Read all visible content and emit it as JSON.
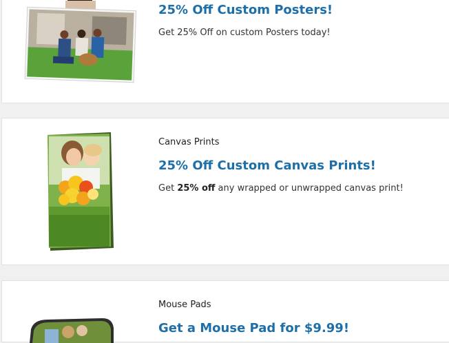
{
  "offers": [
    {
      "title": "25% Off Custom Posters!",
      "description": "Get 25% Off on custom Posters today!",
      "image": "family-poster-photo"
    },
    {
      "category": "Canvas Prints",
      "title": "25% Off Custom Canvas Prints!",
      "description_prefix": "Get ",
      "description_bold": "25% off",
      "description_suffix": " any wrapped or unwrapped canvas print!",
      "image": "mother-child-flowers-canvas"
    },
    {
      "category": "Mouse Pads",
      "title": "Get a Mouse Pad for $9.99!",
      "image": "mouse-pad-photo"
    }
  ]
}
